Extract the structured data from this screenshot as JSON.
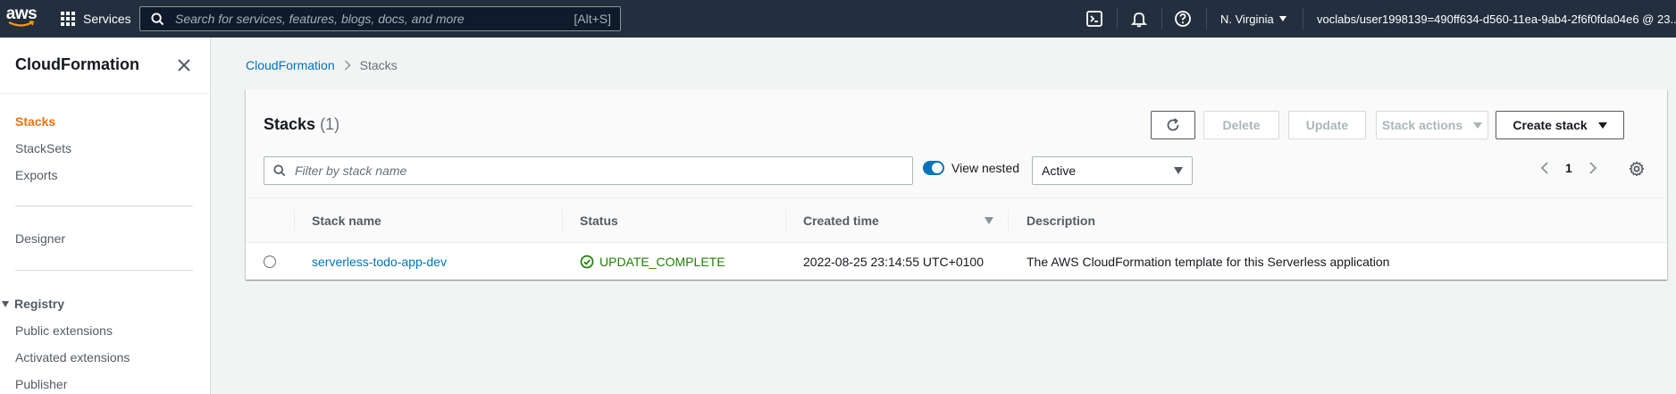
{
  "topnav": {
    "logo_text": "aws",
    "services_label": "Services",
    "search_placeholder": "Search for services, features, blogs, docs, and more",
    "search_shortcut": "[Alt+S]",
    "icons": [
      "cloudshell-icon",
      "bell-icon",
      "help-icon"
    ],
    "region": "N. Virginia",
    "account": "voclabs/user1998139=490ff634-d560-11ea-9ab4-2f6f0fda04e6 @ 23..."
  },
  "sidenav": {
    "title": "CloudFormation",
    "items": [
      {
        "label": "Stacks",
        "active": true
      },
      {
        "label": "StackSets"
      },
      {
        "label": "Exports"
      }
    ],
    "designer": "Designer",
    "registry_label": "Registry",
    "registry_items": [
      "Public extensions",
      "Activated extensions",
      "Publisher"
    ]
  },
  "breadcrumb": {
    "root": "CloudFormation",
    "current": "Stacks"
  },
  "stacks_panel": {
    "title": "Stacks",
    "count": "(1)",
    "buttons": {
      "delete": "Delete",
      "update": "Update",
      "stack_actions": "Stack actions",
      "create_stack": "Create stack"
    },
    "filter_placeholder": "Filter by stack name",
    "view_nested_label": "View nested",
    "view_nested_on": true,
    "status_filter": "Active",
    "page": "1",
    "columns": [
      "Stack name",
      "Status",
      "Created time",
      "Description"
    ],
    "rows": [
      {
        "name": "serverless-todo-app-dev",
        "status": "UPDATE_COMPLETE",
        "created": "2022-08-25 23:14:55 UTC+0100",
        "description": "The AWS CloudFormation template for this Serverless application"
      }
    ]
  },
  "colors": {
    "nav_bg": "#232f3e",
    "accent_orange": "#ec7211",
    "link_blue": "#0073bb",
    "success_green": "#1d8102"
  }
}
